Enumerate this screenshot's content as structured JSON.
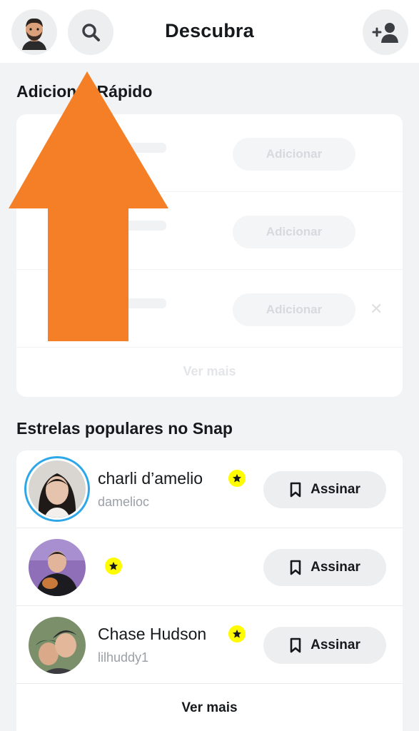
{
  "header": {
    "title": "Descubra",
    "avatar_icon": "bitmoji-avatar-icon",
    "search_icon": "search-icon",
    "add_friend_icon": "add-friend-icon"
  },
  "quick_add": {
    "title": "Adicionar Rápido",
    "rows": [
      {
        "button_label": "Adicionar"
      },
      {
        "button_label": "Adicionar"
      },
      {
        "button_label": "Adicionar"
      }
    ],
    "see_more": "Ver mais"
  },
  "popular_stars": {
    "title": "Estrelas populares no Snap",
    "items": [
      {
        "name": "charli d’amelio",
        "handle": "damelioc",
        "button_label": "Assinar",
        "has_story": true
      },
      {
        "name": "",
        "handle": "",
        "button_label": "Assinar",
        "has_story": false
      },
      {
        "name": "Chase Hudson",
        "handle": "lilhuddy1",
        "button_label": "Assinar",
        "has_story": false
      }
    ],
    "see_more": "Ver mais"
  },
  "colors": {
    "accent_arrow": "#f57f26",
    "story_ring": "#2ea7e8",
    "star_badge": "#fffc00",
    "background": "#f2f3f5"
  }
}
